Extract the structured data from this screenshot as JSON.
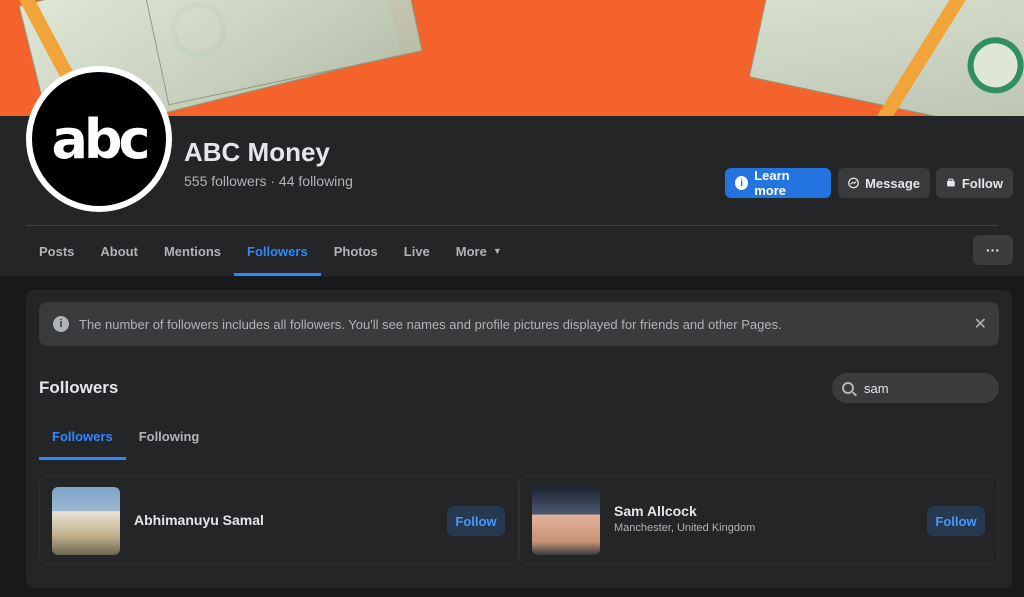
{
  "page": {
    "name": "ABC Money",
    "logo_text": "abc",
    "stats": "555 followers · 44 following"
  },
  "actions": {
    "learn_more": "Learn more",
    "message": "Message",
    "follow": "Follow"
  },
  "nav": {
    "tabs": [
      "Posts",
      "About",
      "Mentions",
      "Followers",
      "Photos",
      "Live",
      "More"
    ],
    "active": "Followers",
    "more_menu": "···"
  },
  "notice": {
    "text": "The number of followers includes all followers. You'll see names and profile pictures displayed for friends and other Pages."
  },
  "followers_section": {
    "title": "Followers",
    "search_value": "sam",
    "tabs": [
      "Followers",
      "Following"
    ],
    "active_tab": "Followers",
    "people": [
      {
        "name": "Abhimanuyu Samal",
        "location": "",
        "button": "Follow"
      },
      {
        "name": "Sam Allcock",
        "location": "Manchester, United Kingdom",
        "button": "Follow"
      }
    ]
  },
  "colors": {
    "accent": "#2d88ff",
    "primary_button": "#2374e1",
    "background": "#18191a",
    "surface": "#242526",
    "cover": "#f4632c"
  },
  "icons": [
    "info-icon",
    "messenger-icon",
    "follow-icon",
    "chevron-down-icon",
    "close-icon",
    "search-icon",
    "more-dots-icon"
  ]
}
